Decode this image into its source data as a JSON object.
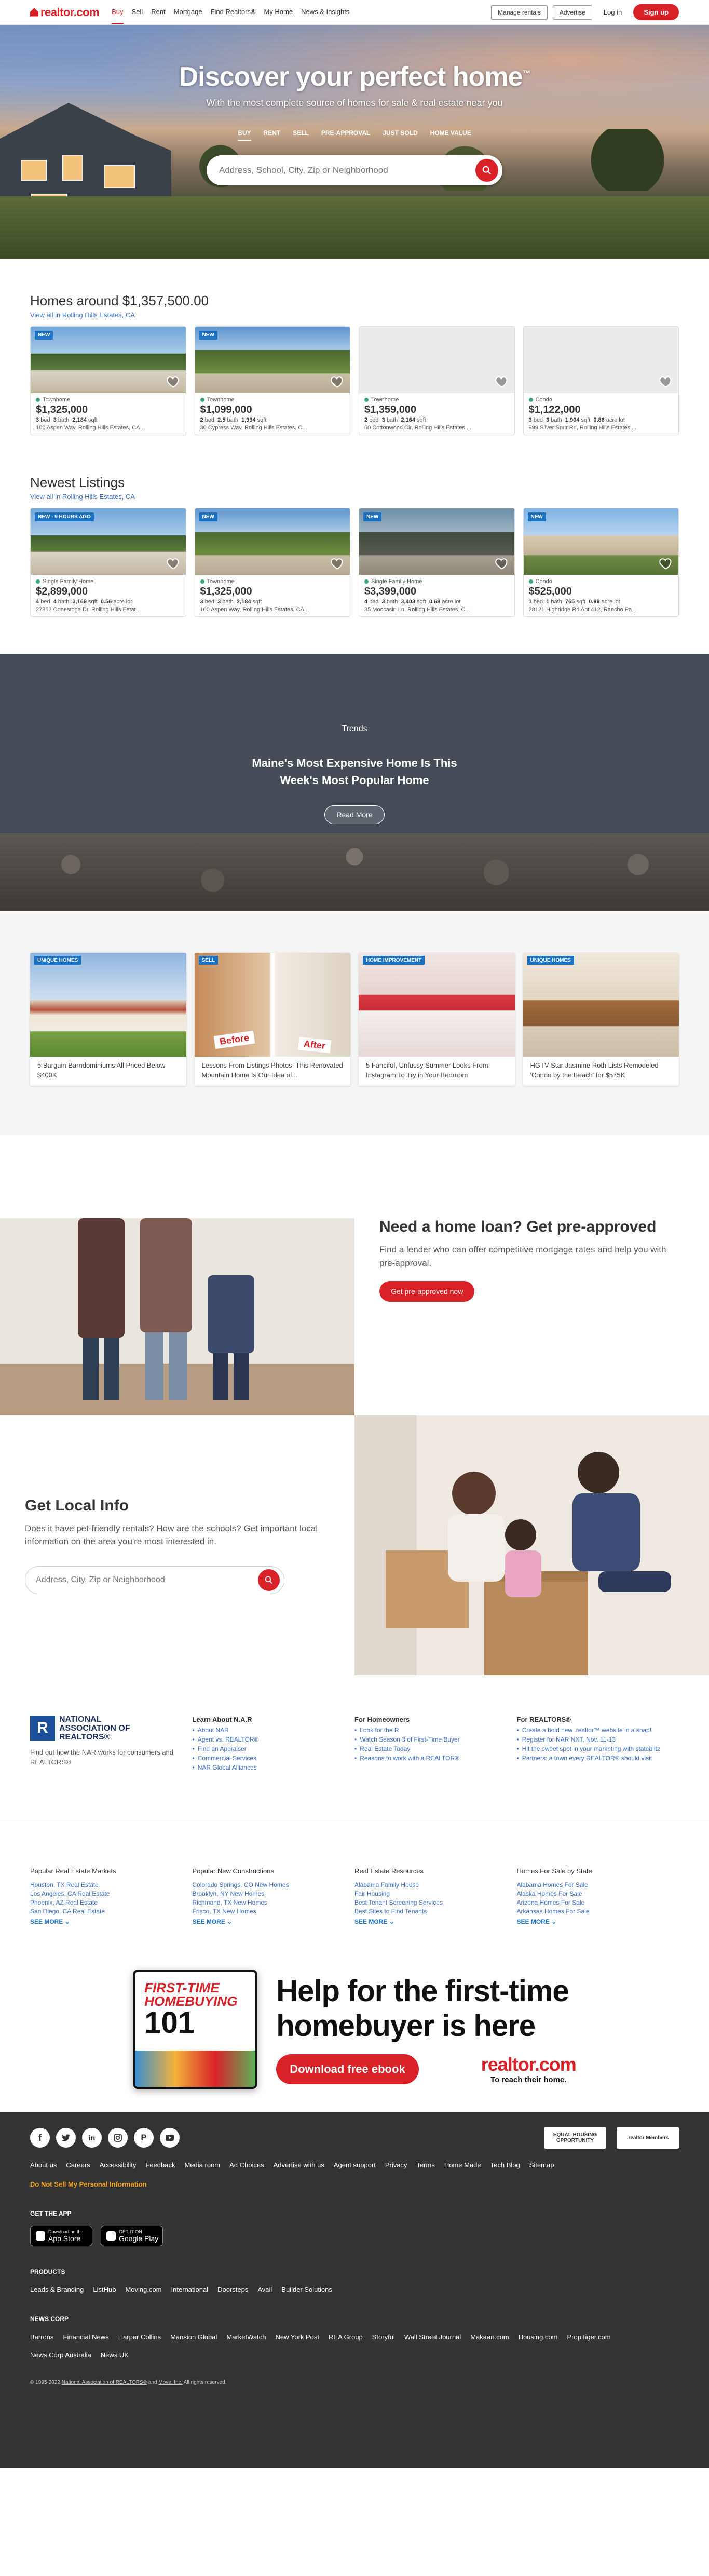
{
  "nav": {
    "logo": "realtor.com",
    "links": [
      "Buy",
      "Sell",
      "Rent",
      "Mortgage",
      "Find Realtors®",
      "My Home",
      "News & Insights"
    ],
    "manage_rentals": "Manage rentals",
    "advertise": "Advertise",
    "login": "Log in",
    "signup": "Sign up"
  },
  "hero": {
    "title": "Discover your perfect home",
    "tm": "™",
    "subtitle": "With the most complete source of homes for sale & real estate near you",
    "tabs": [
      "BUY",
      "RENT",
      "SELL",
      "PRE-APPROVAL",
      "JUST SOLD",
      "HOME VALUE"
    ],
    "search_placeholder": "Address, School, City, Zip or Neighborhood"
  },
  "homes_around": {
    "title": "Homes around $1,357,500.00",
    "subtitle": "View all in Rolling Hills Estates, CA",
    "cards": [
      {
        "badge": "NEW",
        "type": "Townhome",
        "price": "$1,325,000",
        "beds": "3",
        "baths": "3",
        "sqft": "2,184",
        "lot": "",
        "address": "100 Aspen Way, Rolling Hills Estates, CA...",
        "photo": "photo",
        "dot": "#3aa774"
      },
      {
        "badge": "NEW",
        "type": "Townhome",
        "price": "$1,099,000",
        "beds": "2",
        "baths": "2.5",
        "sqft": "1,994",
        "lot": "",
        "address": "30 Cypress Way, Rolling Hills Estates, C...",
        "photo": "photo",
        "dot": "#3aa774"
      },
      {
        "badge": "",
        "type": "Townhome",
        "price": "$1,359,000",
        "beds": "2",
        "baths": "3",
        "sqft": "2,164",
        "lot": "",
        "address": "60 Cottonwood Cir, Rolling Hills Estates,...",
        "photo": "empty",
        "dot": "#3aa774"
      },
      {
        "badge": "",
        "type": "Condo",
        "price": "$1,122,000",
        "beds": "3",
        "baths": "3",
        "sqft": "1,904",
        "lot": "0.86",
        "address": "999 Silver Spur Rd, Rolling Hills Estates,...",
        "photo": "empty",
        "dot": "#3aa774"
      }
    ]
  },
  "newest": {
    "title": "Newest Listings",
    "subtitle": "View all in Rolling Hills Estates, CA",
    "cards": [
      {
        "badge": "NEW - 9 HOURS AGO",
        "type": "Single Family Home",
        "price": "$2,899,000",
        "beds": "4",
        "baths": "4",
        "sqft": "3,169",
        "lot": "0.56",
        "address": "27853 Conestoga Dr, Rolling Hills Estat...",
        "photo": "photo",
        "dot": "#3aa774"
      },
      {
        "badge": "NEW",
        "type": "Townhome",
        "price": "$1,325,000",
        "beds": "3",
        "baths": "3",
        "sqft": "2,184",
        "lot": "",
        "address": "100 Aspen Way, Rolling Hills Estates, CA...",
        "photo": "photo",
        "dot": "#3aa774"
      },
      {
        "badge": "NEW",
        "type": "Single Family Home",
        "price": "$3,399,000",
        "beds": "4",
        "baths": "3",
        "sqft": "3,403",
        "lot": "0.68",
        "address": "35 Moccasin Ln, Rolling Hills Estates, C...",
        "photo": "photo",
        "dot": "#3aa774"
      },
      {
        "badge": "NEW",
        "type": "Condo",
        "price": "$525,000",
        "beds": "1",
        "baths": "1",
        "sqft": "765",
        "lot": "0.99",
        "address": "28121 Highridge Rd Apt 412, Rancho Pa...",
        "photo": "photo",
        "dot": "#3aa774"
      }
    ],
    "bed_label": "bed",
    "bath_label": "bath",
    "sqft_label": "sqft",
    "lot_label": "acre lot"
  },
  "trends": {
    "label": "Trends",
    "title_line1": "Maine's Most Expensive Home Is This",
    "title_line2": "Week's Most Popular Home",
    "button": "Read More"
  },
  "articles": [
    {
      "badge": "UNIQUE HOMES",
      "text": "5 Bargain Barndominiums All Priced Below $400K"
    },
    {
      "badge": "SELL",
      "text": "Lessons From Listings Photos: This Renovated Mountain Home Is Our Idea of...",
      "before": "Before",
      "after": "After"
    },
    {
      "badge": "HOME IMPROVEMENT",
      "text": "5 Fanciful, Unfussy Summer Looks From Instagram To Try in Your Bedroom"
    },
    {
      "badge": "UNIQUE HOMES",
      "text": "HGTV Star Jasmine Roth Lists Remodeled 'Condo by the Beach' for $575K"
    }
  ],
  "loan": {
    "title": "Need a home loan? Get pre-approved",
    "text": "Find a lender who can offer competitive mortgage rates and help you with pre-approval.",
    "button": "Get pre-approved now"
  },
  "local": {
    "title": "Get Local Info",
    "text": "Does it have pet-friendly rentals? How are the schools? Get important local information on the area you're most interested in.",
    "placeholder": "Address, City, Zip or Neighborhood"
  },
  "nar": {
    "logo_letter": "R",
    "logo_line1": "NATIONAL",
    "logo_line2": "ASSOCIATION OF",
    "logo_line3": "REALTORS®",
    "desc": "Find out how the NAR works for consumers and REALTORS®",
    "cols": [
      {
        "title": "Learn About N.A.R",
        "items": [
          "About NAR",
          "Agent vs. REALTOR®",
          "Find an Appraiser",
          "Commercial Services",
          "NAR Global Alliances"
        ]
      },
      {
        "title": "For Homeowners",
        "items": [
          "Look for the R",
          "Watch Season 3 of First-Time Buyer",
          "Real Estate Today",
          "Reasons to work with a REALTOR®"
        ]
      },
      {
        "title": "For REALTORS®",
        "items": [
          "Create a bold new .realtor™ website in a snap!",
          "Register for NAR NXT, Nov. 11-13",
          "Hit the sweet spot in your marketing with stateblitz",
          "Partners: a town every REALTOR® should visit"
        ]
      }
    ]
  },
  "popular": {
    "see_more": "SEE MORE",
    "cols": [
      {
        "title": "Popular Real Estate Markets",
        "items": [
          "Houston, TX Real Estate",
          "Los Angeles, CA Real Estate",
          "Phoenix, AZ Real Estate",
          "San Diego, CA Real Estate"
        ]
      },
      {
        "title": "Popular New Constructions",
        "items": [
          "Colorado Springs, CO New Homes",
          "Brooklyn, NY New Homes",
          "Richmond, TX New Homes",
          "Frisco, TX New Homes"
        ]
      },
      {
        "title": "Real Estate Resources",
        "items": [
          "Alabama Family House",
          "Fair Housing",
          "Best Tenant Screening Services",
          "Best Sites to Find Tenants"
        ]
      },
      {
        "title": "Homes For Sale by State",
        "items": [
          "Alabama Homes For Sale",
          "Alaska Homes For Sale",
          "Arizona Homes For Sale",
          "Arkansas Homes For Sale"
        ]
      }
    ]
  },
  "ebook": {
    "cover_title": "FIRST-TIME HOMEBUYING",
    "cover_number": "101",
    "headline_line1": "Help for the first-time",
    "headline_line2": "homebuyer is here",
    "button": "Download free ebook",
    "brand": "realtor.com",
    "tagline": "To reach their home."
  },
  "footer": {
    "socials": [
      "facebook-icon",
      "twitter-icon",
      "linkedin-icon",
      "instagram-icon",
      "pinterest-icon",
      "youtube-icon"
    ],
    "badge1": "EQUAL HOUSING OPPORTUNITY",
    "badge2": ".realtor Members",
    "links": [
      "About us",
      "Careers",
      "Accessibility",
      "Feedback",
      "Media room",
      "Ad Choices",
      "Advertise with us",
      "Agent support",
      "Privacy",
      "Terms",
      "Home Made",
      "Tech Blog",
      "Sitemap"
    ],
    "privacy": "Do Not Sell My Personal Information",
    "get_app": "GET THE APP",
    "app_store_small": "Download on the",
    "app_store": "App Store",
    "google_small": "GET IT ON",
    "google": "Google Play",
    "products_title": "PRODUCTS",
    "products": [
      "Leads & Branding",
      "ListHub",
      "Moving.com",
      "International",
      "Doorsteps",
      "Avail",
      "Builder Solutions"
    ],
    "newscorp_title": "NEWS CORP",
    "newscorp": [
      "Barrons",
      "Financial News",
      "Harper Collins",
      "Mansion Global",
      "MarketWatch",
      "New York Post",
      "REA Group",
      "Storyful",
      "Wall Street Journal",
      "Makaan.com",
      "Housing.com",
      "PropTiger.com",
      "News Corp Australia",
      "News UK"
    ],
    "copyright_pre": "© 1995-2022",
    "copyright_nar": "National Association of REALTORS®",
    "copyright_and": "and",
    "copyright_move": "Move, Inc.",
    "copyright_post": "All rights reserved."
  }
}
